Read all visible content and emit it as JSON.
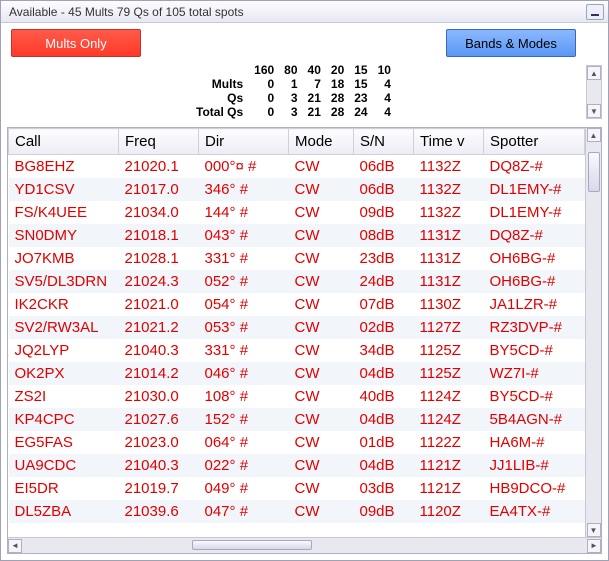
{
  "title": "Available - 45 Mults 79 Qs of 105 total spots",
  "buttons": {
    "mults_only": "Mults Only",
    "bands_modes": "Bands & Modes"
  },
  "summary": {
    "bands": [
      "160",
      "80",
      "40",
      "20",
      "15",
      "10"
    ],
    "rows": [
      {
        "label": "Mults",
        "values": [
          0,
          1,
          7,
          18,
          15,
          4
        ],
        "highlight_index": 3
      },
      {
        "label": "Qs",
        "values": [
          0,
          3,
          21,
          28,
          23,
          4
        ],
        "highlight_index": 3
      },
      {
        "label": "Total Qs",
        "values": [
          0,
          3,
          21,
          28,
          24,
          4
        ],
        "highlight_index": -1
      }
    ]
  },
  "columns": [
    "Call",
    "Freq",
    "Dir",
    "Mode",
    "S/N",
    "Time v",
    "Spotter"
  ],
  "rows": [
    {
      "call": "BG8EHZ",
      "freq": "21020.1",
      "dir": "000°¤ #",
      "mode": "CW",
      "sn": "06dB",
      "time": "1132Z",
      "spotter": "DQ8Z-#"
    },
    {
      "call": "YD1CSV",
      "freq": "21017.0",
      "dir": "346° #",
      "mode": "CW",
      "sn": "06dB",
      "time": "1132Z",
      "spotter": "DL1EMY-#"
    },
    {
      "call": "FS/K4UEE",
      "freq": "21034.0",
      "dir": "144° #",
      "mode": "CW",
      "sn": "09dB",
      "time": "1132Z",
      "spotter": "DL1EMY-#"
    },
    {
      "call": "SN0DMY",
      "freq": "21018.1",
      "dir": "043° #",
      "mode": "CW",
      "sn": "08dB",
      "time": "1131Z",
      "spotter": "DQ8Z-#"
    },
    {
      "call": "JO7KMB",
      "freq": "21028.1",
      "dir": "331° #",
      "mode": "CW",
      "sn": "23dB",
      "time": "1131Z",
      "spotter": "OH6BG-#"
    },
    {
      "call": "SV5/DL3DRN",
      "freq": "21024.3",
      "dir": "052° #",
      "mode": "CW",
      "sn": "24dB",
      "time": "1131Z",
      "spotter": "OH6BG-#"
    },
    {
      "call": "IK2CKR",
      "freq": "21021.0",
      "dir": "054° #",
      "mode": "CW",
      "sn": "07dB",
      "time": "1130Z",
      "spotter": "JA1LZR-#"
    },
    {
      "call": "SV2/RW3AL",
      "freq": "21021.2",
      "dir": "053° #",
      "mode": "CW",
      "sn": "02dB",
      "time": "1127Z",
      "spotter": "RZ3DVP-#"
    },
    {
      "call": "JQ2LYP",
      "freq": "21040.3",
      "dir": "331° #",
      "mode": "CW",
      "sn": "34dB",
      "time": "1125Z",
      "spotter": "BY5CD-#"
    },
    {
      "call": "OK2PX",
      "freq": "21014.2",
      "dir": "046° #",
      "mode": "CW",
      "sn": "04dB",
      "time": "1125Z",
      "spotter": "WZ7I-#"
    },
    {
      "call": "ZS2I",
      "freq": "21030.0",
      "dir": "108° #",
      "mode": "CW",
      "sn": "40dB",
      "time": "1124Z",
      "spotter": "BY5CD-#"
    },
    {
      "call": "KP4CPC",
      "freq": "21027.6",
      "dir": "152° #",
      "mode": "CW",
      "sn": "04dB",
      "time": "1124Z",
      "spotter": "5B4AGN-#"
    },
    {
      "call": "EG5FAS",
      "freq": "21023.0",
      "dir": "064° #",
      "mode": "CW",
      "sn": "01dB",
      "time": "1122Z",
      "spotter": "HA6M-#"
    },
    {
      "call": "UA9CDC",
      "freq": "21040.3",
      "dir": "022° #",
      "mode": "CW",
      "sn": "04dB",
      "time": "1121Z",
      "spotter": "JJ1LIB-#"
    },
    {
      "call": "EI5DR",
      "freq": "21019.7",
      "dir": "049° #",
      "mode": "CW",
      "sn": "03dB",
      "time": "1121Z",
      "spotter": "HB9DCO-#"
    },
    {
      "call": "DL5ZBA",
      "freq": "21039.6",
      "dir": "047° #",
      "mode": "CW",
      "sn": "09dB",
      "time": "1120Z",
      "spotter": "EA4TX-#"
    }
  ]
}
